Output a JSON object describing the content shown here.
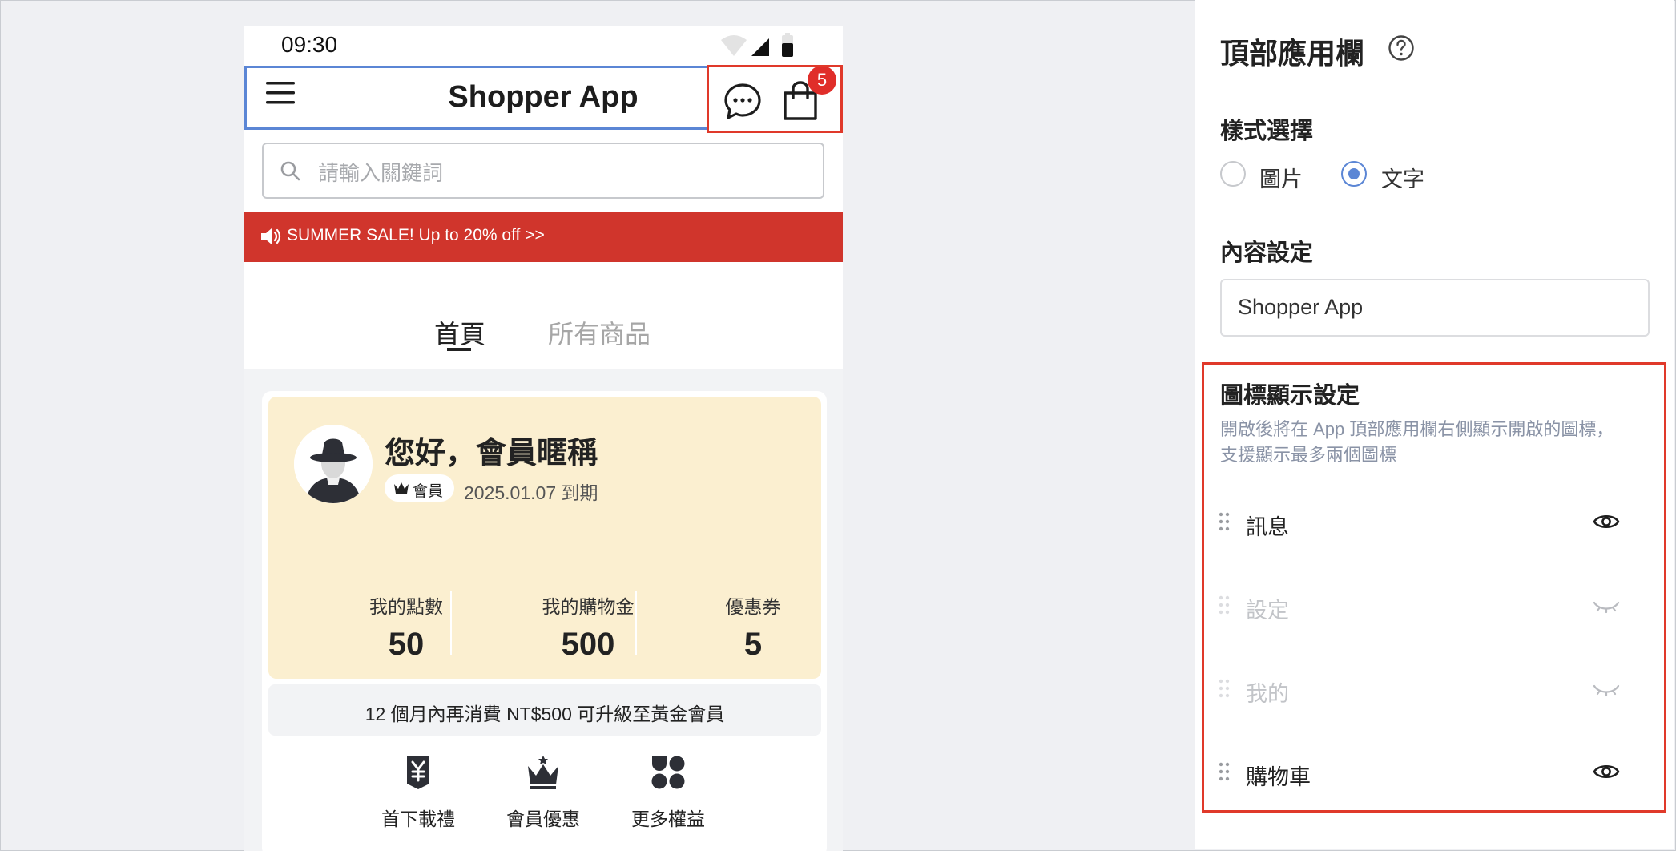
{
  "status_bar": {
    "time": "09:30"
  },
  "app_bar": {
    "title": "Shopper App",
    "menu_icon": "hamburger-icon",
    "chat_icon": "chat-bubble-icon",
    "cart_icon": "shopping-bag-icon",
    "cart_badge": "5"
  },
  "search": {
    "placeholder": "請輸入關鍵詞"
  },
  "banner": {
    "text": "SUMMER SALE! Up to 20% off >>",
    "icon": "speaker-icon"
  },
  "tabs": [
    {
      "label": "首頁",
      "active": true
    },
    {
      "label": "所有商品",
      "active": false
    }
  ],
  "member_card": {
    "greeting": "您好，會員暱稱",
    "tier": "會員",
    "expiry": "2025.01.07 到期",
    "stats": [
      {
        "label": "我的點數",
        "value": "50"
      },
      {
        "label": "我的購物金",
        "value": "500"
      },
      {
        "label": "優惠券",
        "value": "5"
      }
    ],
    "upgrade_text": "12 個月內再消費 NT$500 可升級至黃金會員",
    "perks": [
      {
        "label": "首下載禮",
        "icon": "yen-badge-icon"
      },
      {
        "label": "會員優惠",
        "icon": "crown-icon"
      },
      {
        "label": "更多權益",
        "icon": "grid-dots-icon"
      }
    ]
  },
  "settings": {
    "title": "頂部應用欄",
    "style_section": {
      "heading": "樣式選擇",
      "options": [
        {
          "label": "圖片",
          "selected": false
        },
        {
          "label": "文字",
          "selected": true
        }
      ]
    },
    "content_section": {
      "heading": "內容設定",
      "value": "Shopper App"
    },
    "icon_section": {
      "heading": "圖標顯示設定",
      "description": "開啟後將在 App 頂部應用欄右側顯示開啟的圖標，支援顯示最多兩個圖標",
      "items": [
        {
          "label": "訊息",
          "visible": true
        },
        {
          "label": "設定",
          "visible": false
        },
        {
          "label": "我的",
          "visible": false
        },
        {
          "label": "購物車",
          "visible": true
        }
      ]
    }
  },
  "colors": {
    "accent_blue": "#5b86d5",
    "highlight_red": "#e0392a",
    "banner_red": "#d0352c",
    "member_bg": "#fbefd0",
    "description_gray": "#8a93a6"
  }
}
